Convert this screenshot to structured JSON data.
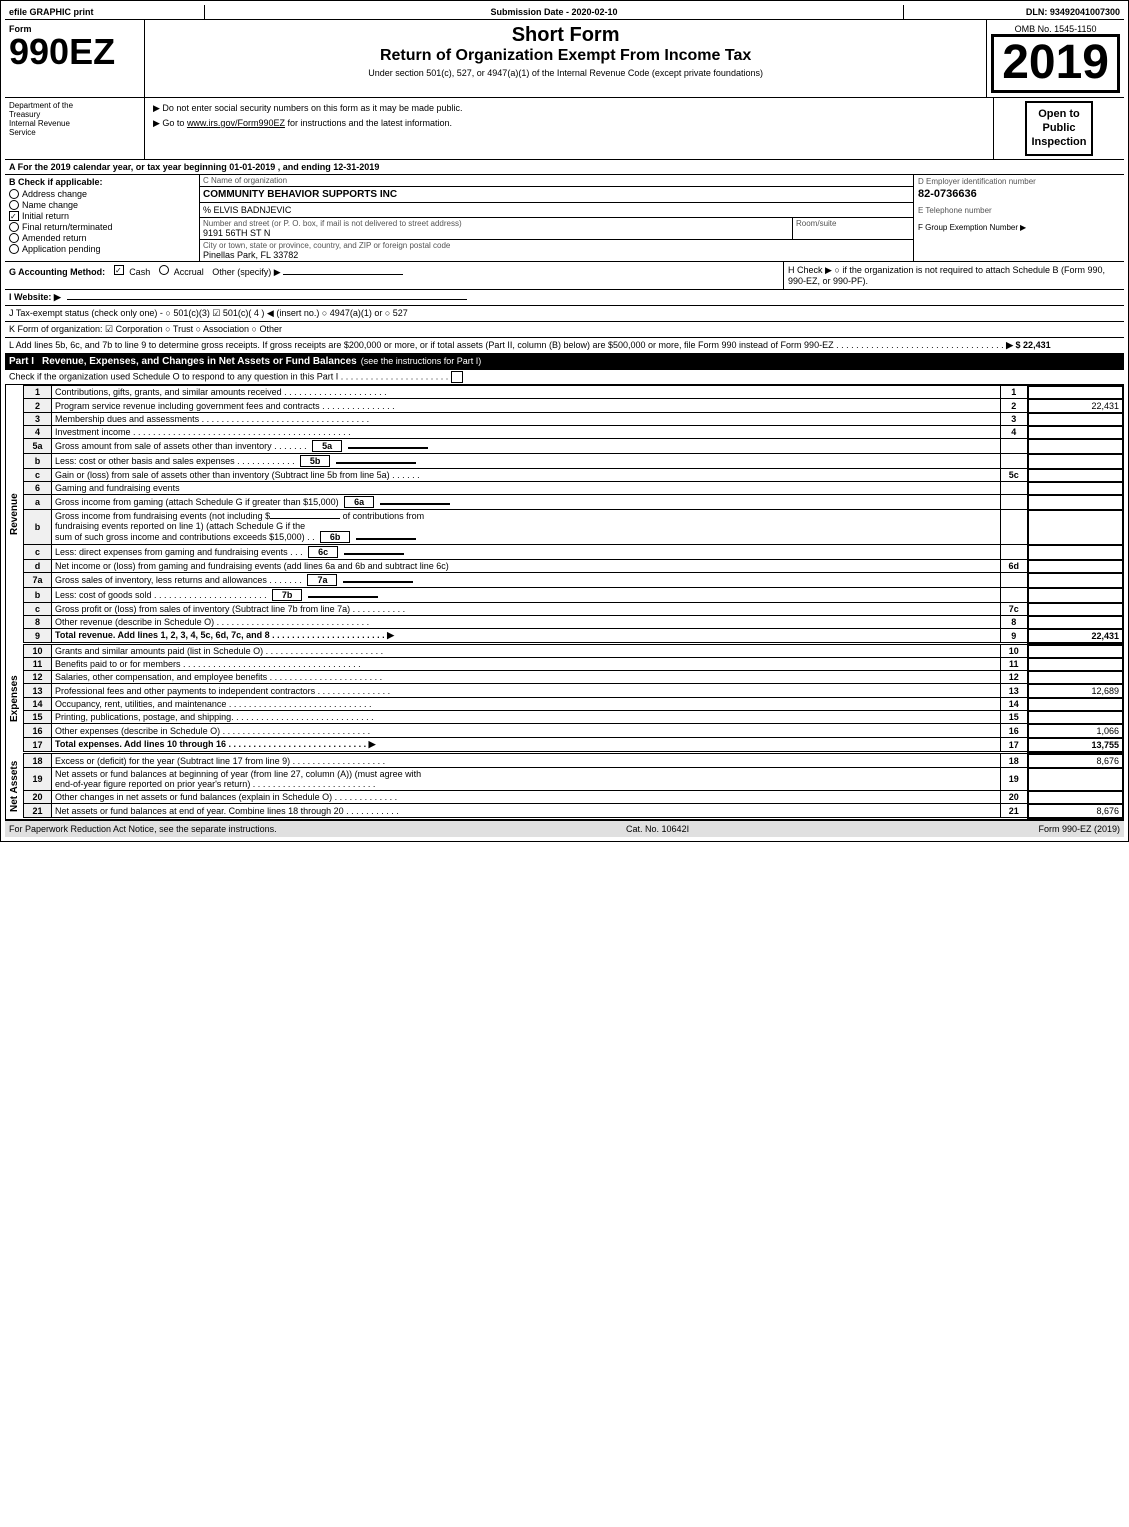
{
  "header": {
    "efile_label": "efile GRAPHIC print",
    "submission_label": "Submission Date - 2020-02-10",
    "dln_label": "DLN: 93492041007300"
  },
  "form": {
    "number": "990EZ",
    "short_form_title": "Short Form",
    "return_title": "Return of Organization Exempt From Income Tax",
    "under_text": "Under section 501(c), 527, or 4947(a)(1) of the Internal Revenue Code (except private foundations)",
    "notice1": "▶ Do not enter social security numbers on this form as it may be made public.",
    "notice2": "▶ Go to www.irs.gov/Form990EZ for instructions and the latest information.",
    "year": "2019",
    "omb": "OMB No. 1545-1150",
    "open_public_line1": "Open to",
    "open_public_line2": "Public",
    "open_public_line3": "Inspection"
  },
  "section_a": {
    "text": "A  For the 2019 calendar year, or tax year beginning 01-01-2019 , and ending 12-31-2019"
  },
  "section_b": {
    "label": "B  Check if applicable:",
    "checkboxes": {
      "address_change": {
        "label": "Address change",
        "checked": false
      },
      "name_change": {
        "label": "Name change",
        "checked": false
      },
      "initial_return": {
        "label": "Initial return",
        "checked": true
      },
      "final_return": {
        "label": "Final return/terminated",
        "checked": false
      },
      "amended_return": {
        "label": "Amended return",
        "checked": false
      },
      "application_pending": {
        "label": "Application pending",
        "checked": false
      }
    }
  },
  "section_c": {
    "label": "C Name of organization",
    "org_name": "COMMUNITY BEHAVIOR SUPPORTS INC",
    "care_of": "% ELVIS BADNJEVIC",
    "street_label": "Number and street (or P. O. box, if mail is not delivered to street address)",
    "street": "9191 56TH ST N",
    "room_label": "Room/suite",
    "room": "",
    "city_label": "City or town, state or province, country, and ZIP or foreign postal code",
    "city": "Pinellas Park, FL  33782"
  },
  "section_d": {
    "label": "D Employer identification number",
    "ein": "82-0736636",
    "phone_label": "E Telephone number",
    "phone": "",
    "group_label": "F Group Exemption Number",
    "group_number": ""
  },
  "dept": {
    "line1": "Department of the",
    "line2": "Treasury",
    "line3": "Internal Revenue",
    "line4": "Service"
  },
  "section_g": {
    "text": "G Accounting Method:",
    "cash_label": "Cash",
    "cash_checked": true,
    "accrual_label": "Accrual",
    "accrual_checked": false,
    "other_label": "Other (specify) ▶"
  },
  "section_h": {
    "text": "H  Check ▶  ○ if the organization is not required to attach Schedule B (Form 990, 990-EZ, or 990-PF)."
  },
  "section_i": {
    "label": "I Website: ▶"
  },
  "section_j": {
    "text": "J Tax-exempt status (check only one) - ○ 501(c)(3) ☑ 501(c)( 4 ) ◀ (insert no.) ○ 4947(a)(1) or ○ 527"
  },
  "section_k": {
    "text": "K Form of organization:  ☑ Corporation   ○ Trust   ○ Association   ○ Other"
  },
  "section_l": {
    "text": "L Add lines 5b, 6c, and 7b to line 9 to determine gross receipts. If gross receipts are $200,000 or more, or if total assets (Part II, column (B) below) are $500,000 or more, file Form 990 instead of Form 990-EZ . . . . . . . . . . . . . . . . . . . . . . . . . . . . . . . . . .",
    "amount": "▶ $ 22,431"
  },
  "part1": {
    "title": "Part I",
    "heading": "Revenue, Expenses, and Changes in Net Assets or Fund Balances",
    "sub_heading": "(see the instructions for Part I)",
    "check_text": "Check if the organization used Schedule O to respond to any question in this Part I . . . . . . . . . . . . . . . . . . . . . .",
    "check_box": "○",
    "lines": [
      {
        "num": "1",
        "desc": "Contributions, gifts, grants, and similar amounts received . . . . . . . . . . . . . . . . . . . . .",
        "amount": ""
      },
      {
        "num": "2",
        "desc": "Program service revenue including government fees and contracts . . . . . . . . . . . . . . .",
        "amount": "22,431"
      },
      {
        "num": "3",
        "desc": "Membership dues and assessments . . . . . . . . . . . . . . . . . . . . . . . . . . . . . . . . . .",
        "amount": ""
      },
      {
        "num": "4",
        "desc": "Investment income . . . . . . . . . . . . . . . . . . . . . . . . . . . . . . . . . . . . . . . . . . . .",
        "amount": ""
      },
      {
        "num": "5a",
        "desc": "Gross amount from sale of assets other than inventory . . . . . . .",
        "ref": "5a",
        "amount": ""
      },
      {
        "num": "5b",
        "desc": "Less: cost or other basis and sales expenses . . . . . . . . . . . .",
        "ref": "5b",
        "amount": ""
      },
      {
        "num": "5c",
        "desc": "Gain or (loss) from sale of assets other than inventory (Subtract line 5b from line 5a) . . . . . .",
        "amount": ""
      },
      {
        "num": "6",
        "desc": "Gaming and fundraising events",
        "amount": ""
      },
      {
        "num": "6a",
        "desc": "Gross income from gaming (attach Schedule G if greater than $15,000)",
        "ref": "6a",
        "amount": ""
      },
      {
        "num": "6b",
        "desc": "Gross income from fundraising events (not including $_____________ of contributions from fundraising events reported on line 1) (attach Schedule G if the sum of such gross income and contributions exceeds $15,000) . .",
        "ref": "6b",
        "amount": ""
      },
      {
        "num": "6c",
        "desc": "Less: direct expenses from gaming and fundraising events . . .",
        "ref": "6c",
        "amount": ""
      },
      {
        "num": "6d",
        "desc": "Net income or (loss) from gaming and fundraising events (add lines 6a and 6b and subtract line 6c)",
        "amount": ""
      },
      {
        "num": "7a",
        "desc": "Gross sales of inventory, less returns and allowances . . . . . . .",
        "ref": "7a",
        "amount": ""
      },
      {
        "num": "7b",
        "desc": "Less: cost of goods sold . . . . . . . . . . . . . . . . . . . . . . .",
        "ref": "7b",
        "amount": ""
      },
      {
        "num": "7c",
        "desc": "Gross profit or (loss) from sales of inventory (Subtract line 7b from line 7a) . . . . . . . . . . .",
        "amount": ""
      },
      {
        "num": "8",
        "desc": "Other revenue (describe in Schedule O) . . . . . . . . . . . . . . . . . . . . . . . . . . . . . . .",
        "amount": ""
      },
      {
        "num": "9",
        "desc": "Total revenue. Add lines 1, 2, 3, 4, 5c, 6d, 7c, and 8 . . . . . . . . . . . . . . . . . . . . . . . ▶",
        "amount": "22,431",
        "bold": true
      }
    ]
  },
  "expenses": {
    "label": "Expenses",
    "lines": [
      {
        "num": "10",
        "desc": "Grants and similar amounts paid (list in Schedule O) . . . . . . . . . . . . . . . . . . . . . . . .",
        "amount": ""
      },
      {
        "num": "11",
        "desc": "Benefits paid to or for members . . . . . . . . . . . . . . . . . . . . . . . . . . . . . . . . . . . .",
        "amount": ""
      },
      {
        "num": "12",
        "desc": "Salaries, other compensation, and employee benefits . . . . . . . . . . . . . . . . . . . . . . .",
        "amount": ""
      },
      {
        "num": "13",
        "desc": "Professional fees and other payments to independent contractors . . . . . . . . . . . . . . .",
        "amount": "12,689"
      },
      {
        "num": "14",
        "desc": "Occupancy, rent, utilities, and maintenance . . . . . . . . . . . . . . . . . . . . . . . . . . . . .",
        "amount": ""
      },
      {
        "num": "15",
        "desc": "Printing, publications, postage, and shipping. . . . . . . . . . . . . . . . . . . . . . . . . . . . .",
        "amount": ""
      },
      {
        "num": "16",
        "desc": "Other expenses (describe in Schedule O) . . . . . . . . . . . . . . . . . . . . . . . . . . . . . .",
        "amount": "1,066"
      },
      {
        "num": "17",
        "desc": "Total expenses. Add lines 10 through 16 . . . . . . . . . . . . . . . . . . . . . . . . . . . ▶",
        "amount": "13,755",
        "bold": true
      }
    ]
  },
  "net_assets": {
    "label": "Net Assets",
    "lines": [
      {
        "num": "18",
        "desc": "Excess or (deficit) for the year (Subtract line 17 from line 9) . . . . . . . . . . . . . . . . . . .",
        "amount": "8,676"
      },
      {
        "num": "19",
        "desc": "Net assets or fund balances at beginning of year (from line 27, column (A)) (must agree with end-of-year figure reported on prior year's return) . . . . . . . . . . . . . . . . . . . . . . . . .",
        "amount": ""
      },
      {
        "num": "20",
        "desc": "Other changes in net assets or fund balances (explain in Schedule O) . . . . . . . . . . . . .",
        "amount": ""
      },
      {
        "num": "21",
        "desc": "Net assets or fund balances at end of year. Combine lines 18 through 20 . . . . . . . . . . .",
        "amount": "8,676"
      }
    ]
  },
  "footer": {
    "left": "For Paperwork Reduction Act Notice, see the separate instructions.",
    "cat": "Cat. No. 10642I",
    "right": "Form 990-EZ (2019)"
  }
}
